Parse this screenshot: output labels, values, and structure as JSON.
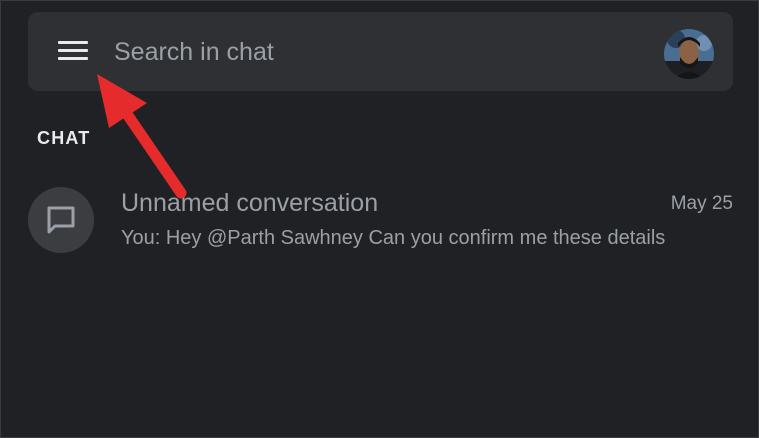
{
  "header": {
    "menu_icon": "hamburger-menu-icon",
    "search_placeholder": "Search in chat",
    "account_avatar": "user-avatar"
  },
  "sections": [
    {
      "label": "CHAT",
      "items": [
        {
          "icon": "chat-bubble-icon",
          "title": "Unnamed conversation",
          "date": "May 25",
          "preview": "You: Hey @Parth Sawhney  Can you confirm me these details"
        }
      ]
    }
  ],
  "annotation": {
    "arrow_color": "#e52b2b",
    "arrow_points_to": "hamburger-menu-icon"
  },
  "colors": {
    "background": "#202124",
    "search_bar": "#2f3033",
    "primary_text": "#e8eaed",
    "secondary_text": "#9aa0a6"
  }
}
